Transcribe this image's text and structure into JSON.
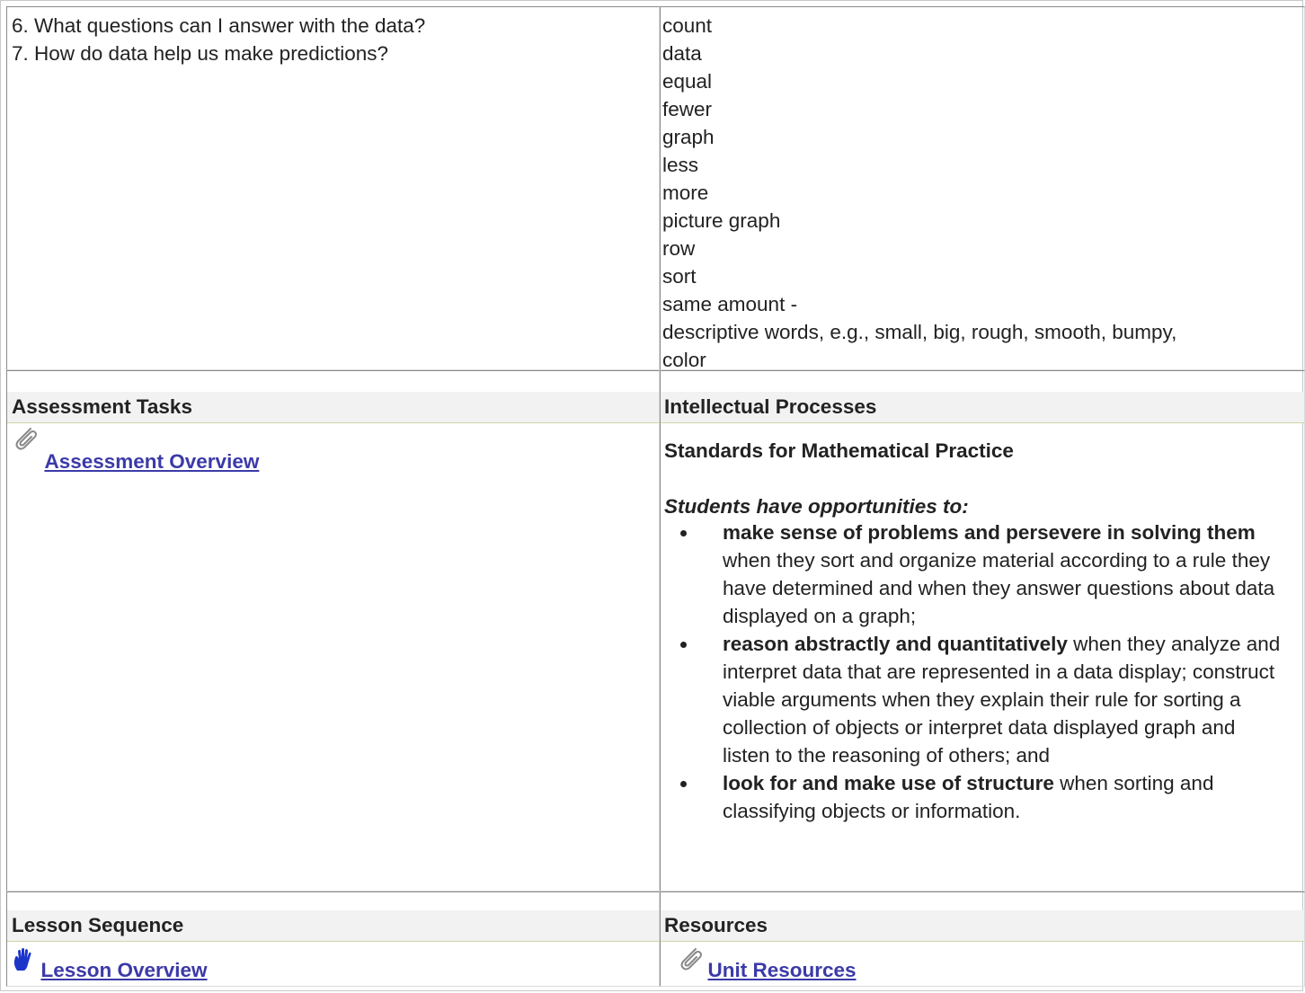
{
  "questions": [
    "6. What questions can I answer with the data?",
    "7. How do data help us make predictions?"
  ],
  "vocabulary": [
    "count",
    "data",
    "equal",
    "fewer",
    "graph",
    "less",
    "more",
    "picture graph",
    "row",
    "sort",
    "same amount -",
    "descriptive words, e.g., small, big, rough, smooth, bumpy,",
    "color"
  ],
  "assessment": {
    "heading": "Assessment Tasks",
    "link_label": "Assessment Overview",
    "icon": "paperclip-icon"
  },
  "intellectual": {
    "heading": "Intellectual Processes",
    "subheading": "Standards for Mathematical Practice",
    "intro": "Students have opportunities to:",
    "items": [
      {
        "bold": "make sense of problems and persevere in solving them",
        "rest": " when they sort and organize material according to a rule they have determined and when they answer questions about data displayed on a graph;"
      },
      {
        "bold": "reason abstractly and quantitatively",
        "rest": " when they analyze and interpret data that are represented in a data display; construct viable arguments when they explain their rule for sorting a collection of objects or interpret data displayed graph and listen to the reasoning of others; and"
      },
      {
        "bold": "look for and make use of structure",
        "rest": " when sorting and classifying objects or information."
      }
    ]
  },
  "lesson": {
    "heading": "Lesson Sequence",
    "link_label": "Lesson Overview",
    "icon": "hand-icon"
  },
  "resources": {
    "heading": "Resources",
    "link_label": "Unit Resources",
    "icon": "paperclip-icon"
  },
  "colors": {
    "link": "#3b3aa8",
    "header_bg": "#f2f2f2",
    "header_rule": "#cfd6a8",
    "hand_icon": "#1c35c9"
  }
}
